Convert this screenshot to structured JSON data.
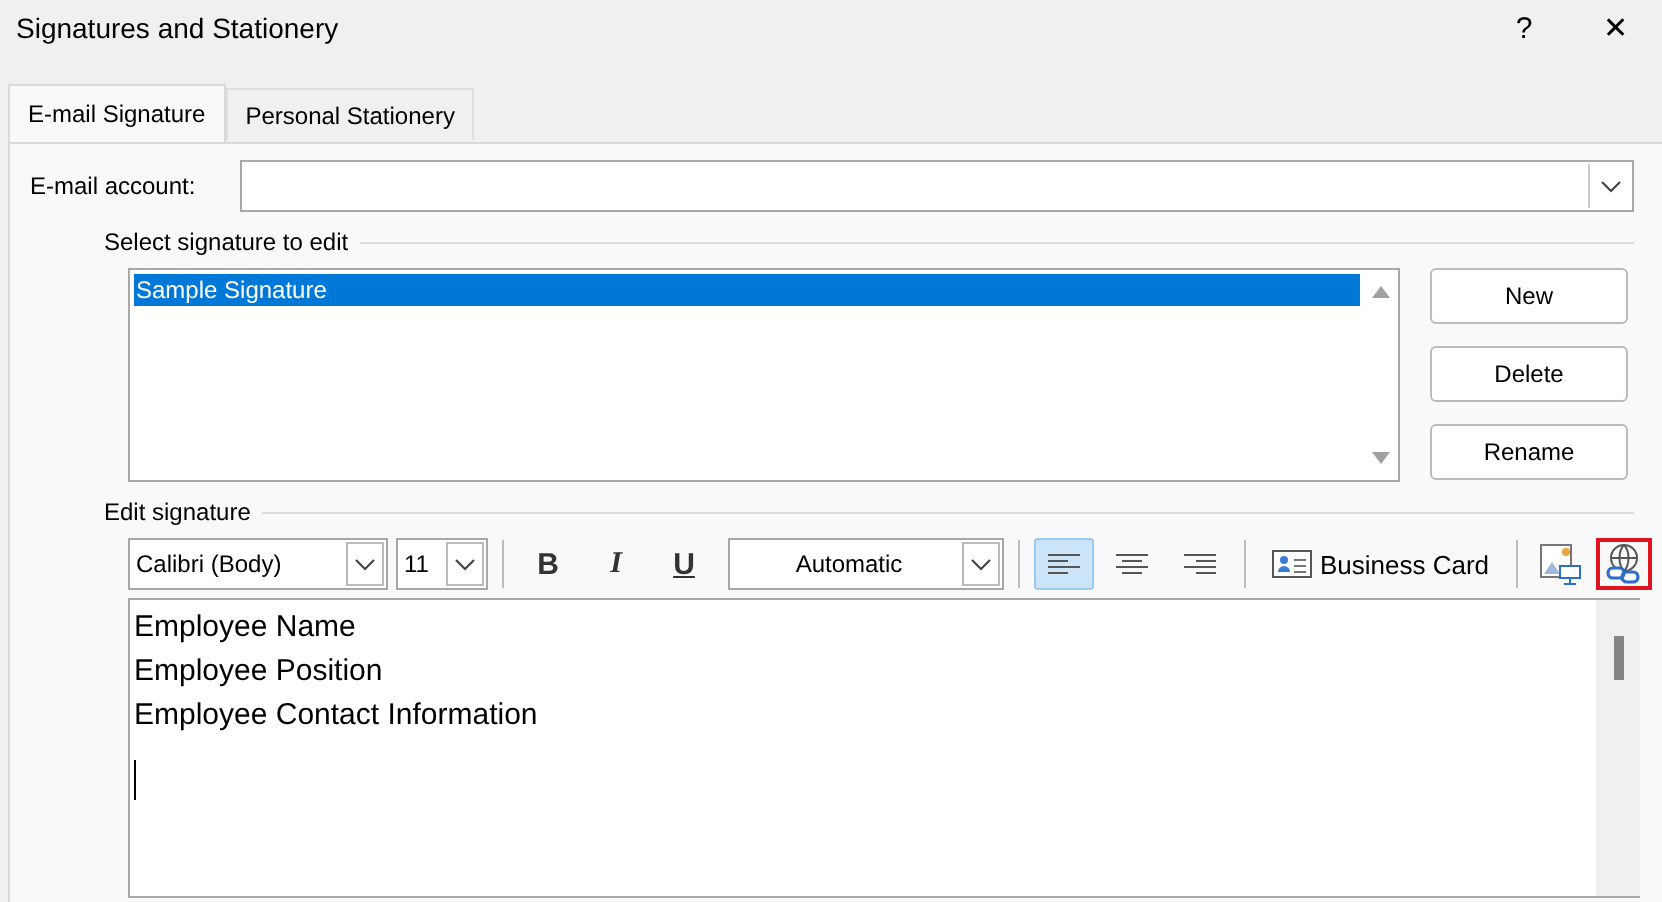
{
  "window": {
    "title": "Signatures and Stationery",
    "help": "?",
    "close": "✕"
  },
  "tabs": [
    {
      "label": "E-mail Signature",
      "selected": true
    },
    {
      "label": "Personal Stationery",
      "selected": false
    }
  ],
  "account": {
    "label": "E-mail account:"
  },
  "select_section": {
    "title": "Select signature to edit",
    "items": [
      {
        "label": "Sample Signature",
        "selected": true
      }
    ],
    "buttons": [
      "New",
      "Delete",
      "Rename"
    ]
  },
  "edit_section": {
    "title": "Edit signature",
    "font": "Calibri (Body)",
    "size": "11",
    "bold": "B",
    "italic": "I",
    "underline": "U",
    "font_color": "Automatic",
    "align": [
      {
        "kind": "left",
        "selected": true
      },
      {
        "kind": "center",
        "selected": false
      },
      {
        "kind": "right",
        "selected": false
      }
    ],
    "business_card": "Business Card",
    "icons": [
      {
        "kind": "picture",
        "highlighted": false
      },
      {
        "kind": "hyperlink",
        "highlighted": true
      }
    ],
    "lines": [
      "Employee Name",
      "Employee Position",
      "Employee Contact Information"
    ]
  }
}
